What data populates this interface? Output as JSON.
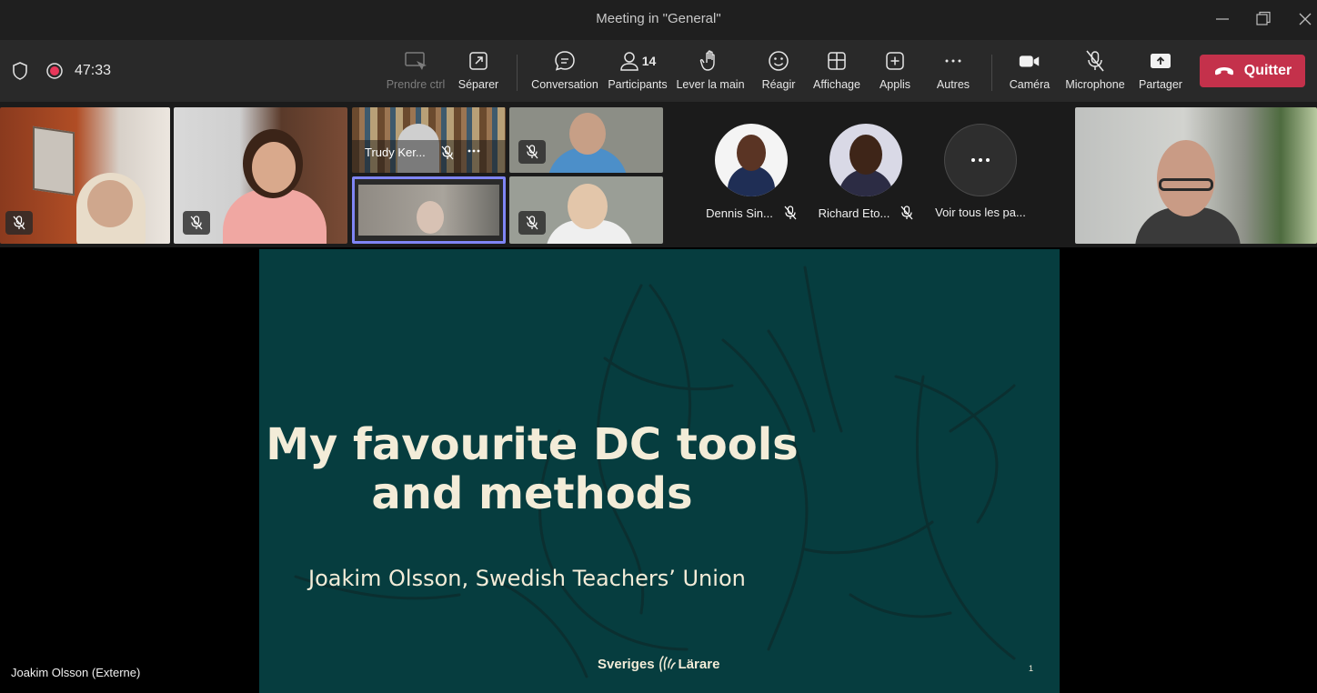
{
  "window": {
    "title": "Meeting in \"General\""
  },
  "toolbar": {
    "timer": "47:33",
    "buttons": {
      "control": "Prendre ctrl",
      "separate": "Séparer",
      "chat": "Conversation",
      "participants": "Participants",
      "participant_count": "14",
      "raise_hand": "Lever la main",
      "react": "Réagir",
      "view": "Affichage",
      "apps": "Applis",
      "more": "Autres",
      "camera": "Caméra",
      "mic": "Microphone",
      "share": "Partager",
      "quit": "Quitter"
    }
  },
  "participants": {
    "tiles": [
      {
        "name": "",
        "muted": true
      },
      {
        "name": "",
        "muted": true
      },
      {
        "name": "Trudy Ker...",
        "muted": true
      },
      {
        "name": "",
        "muted": true
      },
      {
        "name": "",
        "muted": false,
        "active": true
      },
      {
        "name": "",
        "muted": true
      },
      {
        "name": "",
        "muted": false
      }
    ],
    "avatars": [
      {
        "name": "Dennis Sin...",
        "muted": true
      },
      {
        "name": "Richard Eto...",
        "muted": true
      }
    ],
    "see_all": "Voir tous les pa..."
  },
  "stage": {
    "presenter": "Joakim Olsson (Externe)",
    "slide": {
      "title_line1": "My favourite DC tools",
      "title_line2": "and methods",
      "subtitle": "Joakim Olsson, Swedish Teachers’ Union",
      "logo_left": "Sveriges",
      "logo_right": "Lärare",
      "page": "1"
    }
  },
  "colors": {
    "titlebar": "#1f1f1f",
    "toolbar": "#292929",
    "quit": "#c4314b",
    "slide_bg": "#063d3f",
    "slide_text": "#f3ecd8",
    "active_border": "#7f85f5"
  }
}
